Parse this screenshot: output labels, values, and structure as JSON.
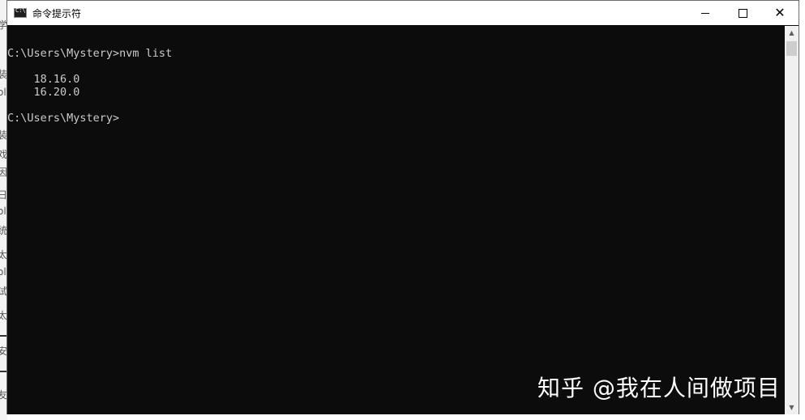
{
  "window": {
    "title": "命令提示符",
    "icon": "cmd-icon",
    "controls": {
      "minimize": "minimize-icon",
      "maximize": "maximize-icon",
      "close": "close-icon"
    }
  },
  "console": {
    "lines": [
      "",
      "C:\\Users\\Mystery>nvm list",
      "",
      "    18.16.0",
      "    16.20.0",
      "",
      "C:\\Users\\Mystery>"
    ]
  },
  "background_window": {
    "fragments": [
      "学",
      "装",
      "ol",
      "装",
      "戏",
      "因",
      "日",
      "ol",
      "统",
      "太",
      "ol",
      "试",
      "太",
      "安",
      "友"
    ]
  },
  "watermark": "知乎 @我在人间做项目",
  "colors": {
    "console_bg": "#0c0c0c",
    "console_text": "#cccccc",
    "titlebar_bg": "#ffffff"
  }
}
